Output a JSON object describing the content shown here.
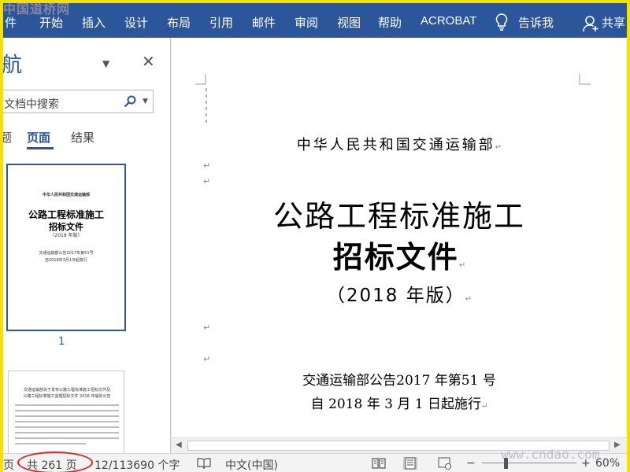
{
  "ribbon": {
    "tabs": [
      "件",
      "开始",
      "插入",
      "设计",
      "布局",
      "引用",
      "邮件",
      "审阅",
      "视图",
      "帮助",
      "ACROBAT"
    ],
    "tell_me": "告诉我",
    "share": "共享"
  },
  "watermark_top": "中国道桥网",
  "watermark_bottom": "www.cndao.com",
  "nav": {
    "title": "航",
    "search_placeholder": "文档中搜索",
    "tabs": [
      "题",
      "页面",
      "结果"
    ],
    "active_tab": "页面",
    "thumbnail_page1": {
      "line1": "中华人民共和国交通运输部",
      "line2": "公路工程标准施工",
      "line3": "招标文件",
      "line4": "（2018 年版）",
      "line5": "交通运输部公告2017年第51号",
      "line6": "自2018年3月1日起施行",
      "page_number": "1"
    },
    "thumbnail_page2": {
      "heading1": "交通运输部关于发布公路工程标准施工招标文件及",
      "heading2": "公路工程标准施工监理招标文件 2018 年版的公告"
    }
  },
  "document": {
    "organization": "中华人民共和国交通运输部",
    "title_line1": "公路工程标准施工",
    "title_line2": "招标文件",
    "edition": "（2018 年版）",
    "notice": "交通运输部公告2017 年第51 号",
    "effective": "自 2018 年 3 月 1 日起施行",
    "paragraph_mark": "↵"
  },
  "status": {
    "page_label": "页",
    "total_pages": "共 261 页",
    "word_count": "12/113690 个字",
    "language": "中文(中国)",
    "zoom": "60%",
    "zoom_minus": "−",
    "zoom_plus": "+"
  },
  "colors": {
    "ribbon": "#2b579a",
    "frame": "#f5e000",
    "highlight_oval": "#e02020"
  }
}
